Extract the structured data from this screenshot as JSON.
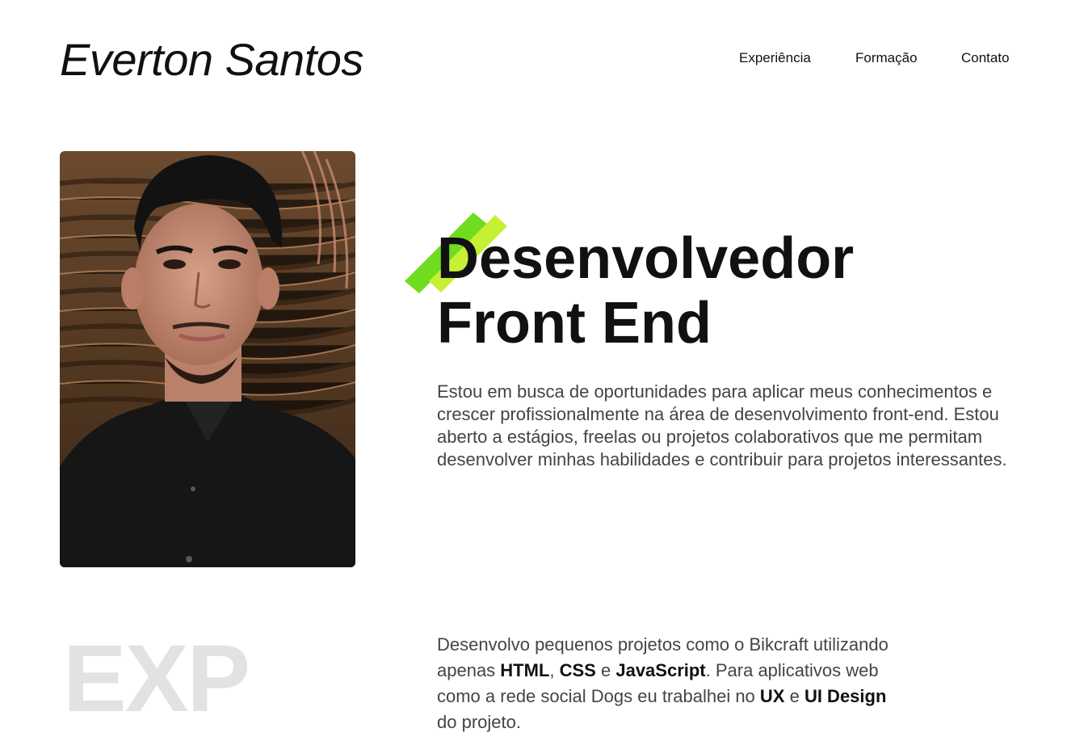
{
  "header": {
    "logo": "Everton Santos",
    "nav": [
      "Experiência",
      "Formação",
      "Contato"
    ]
  },
  "hero": {
    "title_line1": "Desenvolvedor",
    "title_line2": "Front End",
    "intro": "Estou em busca de oportunidades para aplicar meus conhecimentos e crescer profissionalmente na área de desenvolvimento front-end. Estou aberto a estágios, freelas ou projetos colaborativos que me permitam desenvolver minhas habilidades e contribuir para projetos interessantes.",
    "photo_icon": "portrait-photo"
  },
  "experience": {
    "bg_label": "EXP",
    "text_1": "Desenvolvo pequenos projetos como o Bikcraft utilizando apenas ",
    "html": "HTML",
    "sep_1": ", ",
    "css": "CSS",
    "sep_2": " e ",
    "js": "JavaScript",
    "text_2": ". Para aplicativos web como a rede social Dogs eu trabalhei no ",
    "ux": "UX",
    "sep_3": " e ",
    "ui": "UI Design",
    "text_3": " do projeto."
  },
  "colors": {
    "accent_green": "#6fdc1f",
    "accent_lime": "#c6f033",
    "title": "#111111",
    "body_text": "#444444",
    "exp_bg": "#e2e2e2"
  }
}
